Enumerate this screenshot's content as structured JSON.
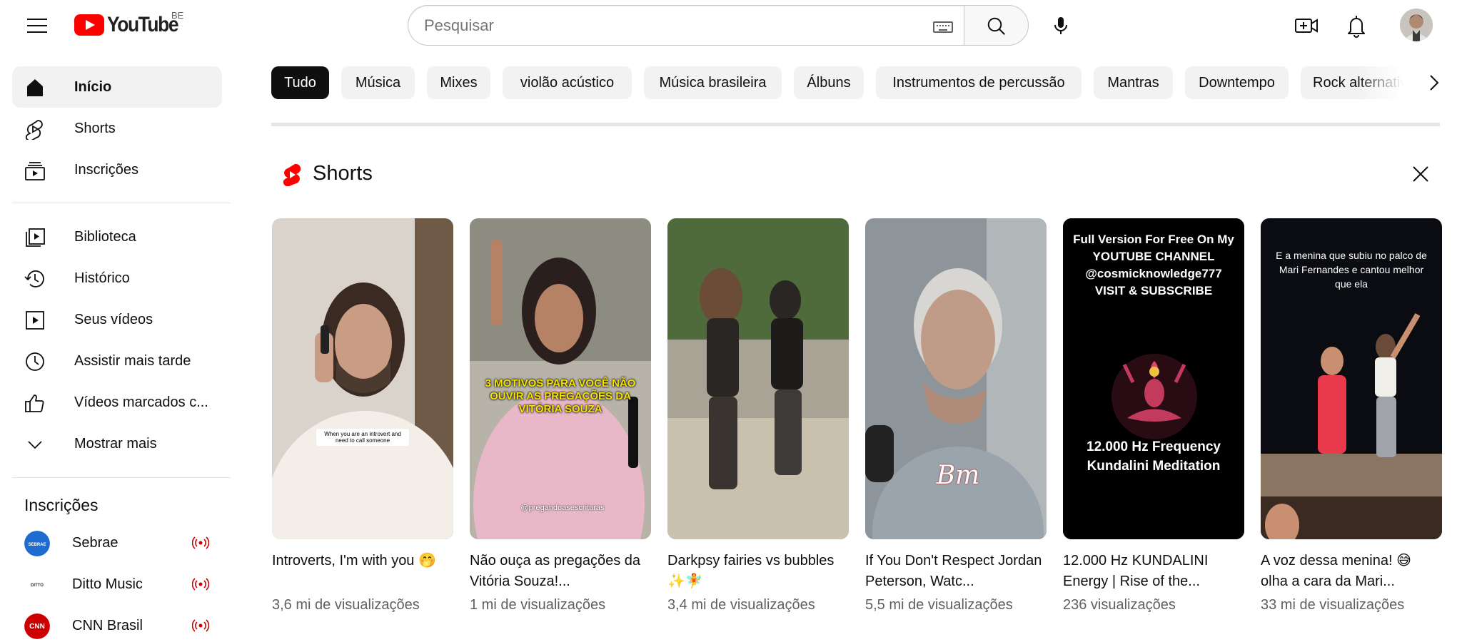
{
  "masthead": {
    "logo_text": "YouTube",
    "region": "BE",
    "search_placeholder": "Pesquisar"
  },
  "sidebar": {
    "items": [
      {
        "label": "Início",
        "icon": "home-icon",
        "active": true
      },
      {
        "label": "Shorts",
        "icon": "shorts-icon"
      },
      {
        "label": "Inscrições",
        "icon": "subscriptions-icon"
      },
      {
        "label": "Biblioteca",
        "icon": "library-icon"
      },
      {
        "label": "Histórico",
        "icon": "history-icon"
      },
      {
        "label": "Seus vídeos",
        "icon": "your-videos-icon"
      },
      {
        "label": "Assistir mais tarde",
        "icon": "watch-later-icon"
      },
      {
        "label": "Vídeos marcados c...",
        "icon": "liked-videos-icon"
      },
      {
        "label": "Mostrar mais",
        "icon": "chevron-down-icon"
      }
    ],
    "subscriptions_title": "Inscrições",
    "subscriptions": [
      {
        "name": "Sebrae",
        "avatar_text": "SEBRAE",
        "live": true
      },
      {
        "name": "Ditto Music",
        "avatar_text": "DITTO",
        "live": true
      },
      {
        "name": "CNN Brasil",
        "avatar_text": "CNN",
        "live": true
      }
    ]
  },
  "chips": [
    "Tudo",
    "Música",
    "Mixes",
    "violão acústico",
    "Música brasileira",
    "Álbuns",
    "Instrumentos de percussão",
    "Mantras",
    "Downtempo",
    "Rock alternativo"
  ],
  "shorts": {
    "title": "Shorts",
    "items": [
      {
        "title": "Introverts, I'm with you 🤭",
        "views": "3,6 mi de visualizações",
        "overlay": "When you are an introvert and need to call someone"
      },
      {
        "title": "Não ouça as pregações da Vitória Souza!...",
        "views": "1 mi de visualizações",
        "overlay": "3 MOTIVOS PARA VOCÊ NÃO OUVIR AS PREGAÇÕES DA VITÓRIA SOUZA",
        "handle": "@pregandoasescrituras"
      },
      {
        "title": "Darkpsy fairies vs bubbles ✨🧚",
        "views": "3,4 mi de visualizações"
      },
      {
        "title": "If You Don't Respect Jordan Peterson, Watc...",
        "views": "5,5 mi de visualizações",
        "overlay": "Bm"
      },
      {
        "title": "12.000 Hz KUNDALINI Energy | Rise of the...",
        "views": "236 visualizações",
        "overlay_top": "Full Version For Free On My YOUTUBE CHANNEL @cosmicknowledge777 VISIT & SUBSCRIBE",
        "overlay_bottom": "12.000 Hz Frequency Kundalini Meditation"
      },
      {
        "title": "A voz dessa menina! 😅 olha a cara da Mari...",
        "views": "33 mi de visualizações",
        "overlay": "E a menina que subiu no palco de Mari Fernandes e cantou melhor que ela"
      }
    ]
  }
}
